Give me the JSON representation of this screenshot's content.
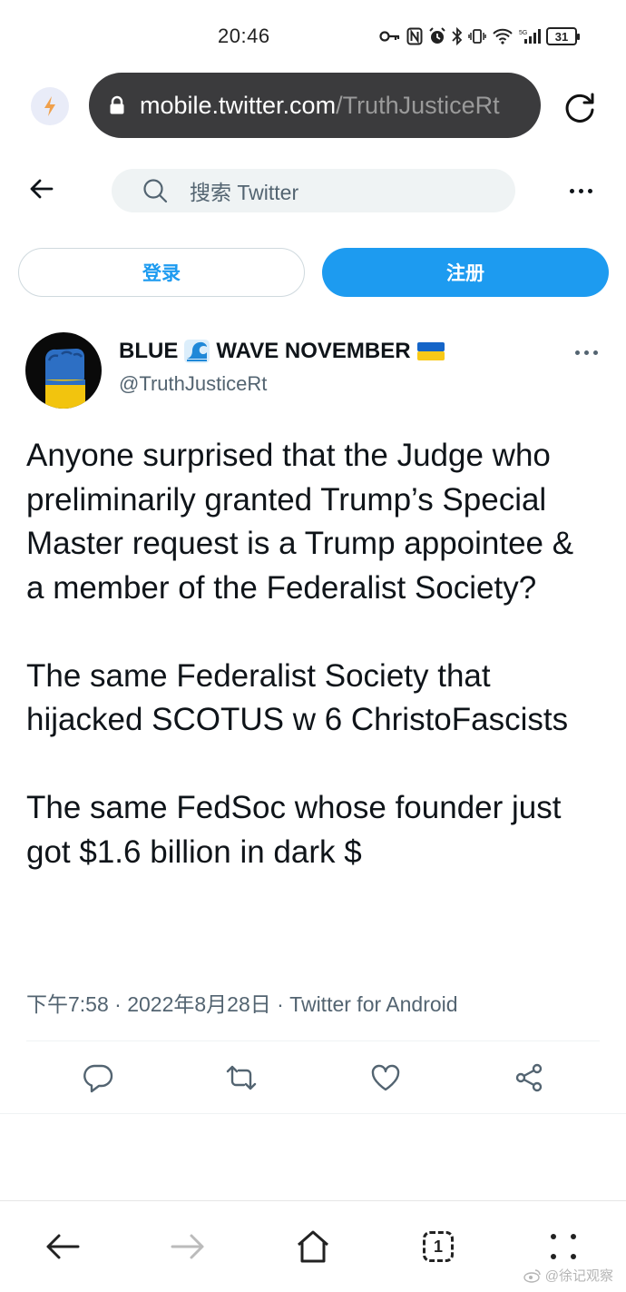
{
  "status_bar": {
    "time": "20:46",
    "network": "5G",
    "battery": "31"
  },
  "browser": {
    "url_host": "mobile.twitter.com",
    "url_path": "/TruthJusticeRt"
  },
  "header": {
    "search_placeholder": "搜索 Twitter"
  },
  "auth": {
    "login_label": "登录",
    "signup_label": "注册"
  },
  "tweet": {
    "display_name": "BLUE",
    "display_name_rest": "WAVE NOVEMBER",
    "username": "@TruthJusticeRt",
    "paragraphs": [
      "Anyone surprised that the Judge who preliminarily granted Trump’s Special Master request is a Trump appointee & a member of the Federalist Society?",
      "The same Federalist Society that hijacked SCOTUS w 6 ChristoFascists",
      "The same FedSoc whose founder just got $1.6 billion in dark $"
    ],
    "meta": "下午7:58 · 2022年8月28日 · Twitter for Android"
  },
  "actions": {
    "reply": "reply-icon",
    "retweet": "retweet-icon",
    "like": "heart-icon",
    "share": "share-icon"
  },
  "bottom_nav": {
    "tab_count": "1"
  },
  "watermark": "@徐记观察",
  "colors": {
    "brand": "#1d9bf0",
    "text": "#0f1419",
    "secondary": "#536471",
    "url_bar": "#3b3b3d"
  }
}
